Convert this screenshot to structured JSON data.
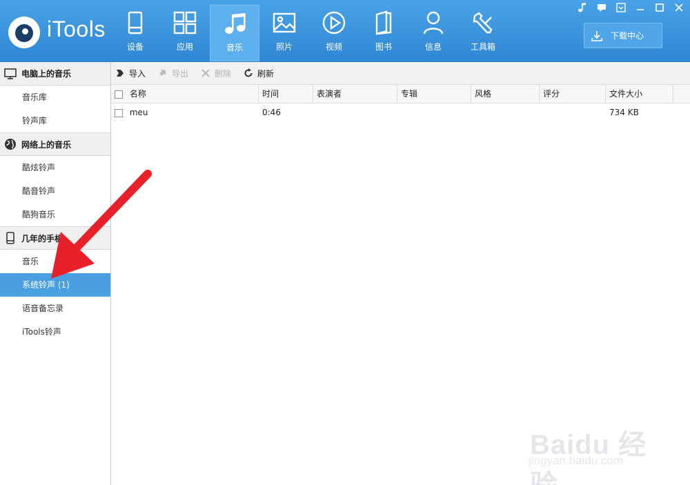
{
  "app": {
    "name": "iTools"
  },
  "nav": [
    {
      "label": "设备",
      "icon": "device-icon"
    },
    {
      "label": "应用",
      "icon": "apps-icon"
    },
    {
      "label": "音乐",
      "icon": "music-icon"
    },
    {
      "label": "照片",
      "icon": "photo-icon"
    },
    {
      "label": "视频",
      "icon": "video-icon"
    },
    {
      "label": "图书",
      "icon": "book-icon"
    },
    {
      "label": "信息",
      "icon": "contacts-icon"
    },
    {
      "label": "工具箱",
      "icon": "toolbox-icon"
    }
  ],
  "header": {
    "download_label": "下载中心"
  },
  "sidebar": {
    "computer": {
      "title": "电脑上的音乐",
      "items": [
        "音乐库",
        "铃声库"
      ]
    },
    "online": {
      "title": "网络上的音乐",
      "items": [
        "酷炫铃声",
        "酷音铃声",
        "酷狗音乐"
      ]
    },
    "phone": {
      "title": "几年的手机",
      "items": [
        "音乐",
        "系统铃声 (1)",
        "语音备忘录",
        "iTools铃声"
      ]
    }
  },
  "toolbar": {
    "import": "导入",
    "export": "导出",
    "delete": "删除",
    "refresh": "刷新"
  },
  "table": {
    "columns": [
      "名称",
      "时间",
      "表演者",
      "专辑",
      "风格",
      "评分",
      "文件大小"
    ],
    "rows": [
      {
        "name": "meu",
        "time": "0:46",
        "artist": "",
        "album": "",
        "genre": "",
        "rating": "",
        "size": "734 KB"
      }
    ]
  },
  "watermark": {
    "main": "Baidu 经验",
    "sub": "jingyan.baidu.com"
  },
  "colors": {
    "header": "#2f86d3",
    "selected": "#4a9fe0",
    "arrow": "#e8202a"
  }
}
